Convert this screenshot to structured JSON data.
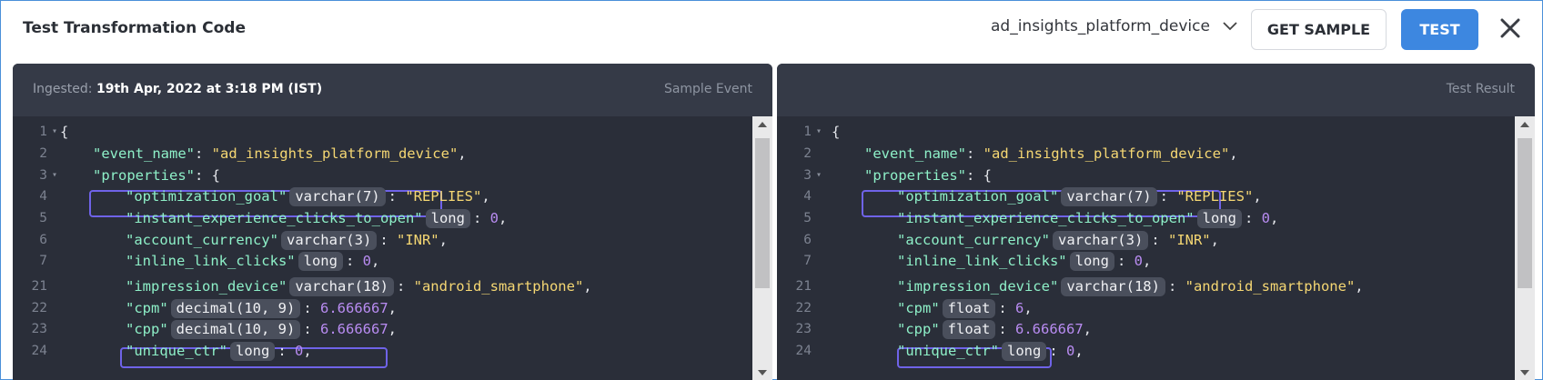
{
  "header": {
    "title": "Test Transformation Code",
    "event_selector": "ad_insights_platform_device",
    "get_sample_label": "GET SAMPLE",
    "test_label": "TEST"
  },
  "left_panel": {
    "ingested_label": "Ingested:",
    "ingested_value": "19th Apr, 2022 at 3:18 PM (IST)",
    "panel_label": "Sample Event",
    "lines": [
      {
        "ln": "1",
        "fold": true,
        "segments": [
          {
            "t": "{",
            "c": "p"
          }
        ]
      },
      {
        "ln": "2",
        "indent": 1,
        "segments": [
          {
            "t": "\"event_name\"",
            "c": "k"
          },
          {
            "t": ": ",
            "c": "p"
          },
          {
            "t": "\"ad_insights_platform_device\"",
            "c": "s"
          },
          {
            "t": ",",
            "c": "p"
          }
        ]
      },
      {
        "ln": "3",
        "fold": true,
        "indent": 1,
        "segments": [
          {
            "t": "\"properties\"",
            "c": "k"
          },
          {
            "t": ": {",
            "c": "p"
          }
        ]
      },
      {
        "ln": "4",
        "indent": 2,
        "segments": [
          {
            "t": "\"optimization_goal\"",
            "c": "k"
          },
          {
            "t": "varchar(7)",
            "c": "type"
          },
          {
            "t": ": ",
            "c": "p"
          },
          {
            "t": "\"REPLIES\"",
            "c": "s"
          },
          {
            "t": ",",
            "c": "p"
          }
        ]
      },
      {
        "ln": "5",
        "indent": 2,
        "segments": [
          {
            "t": "\"instant_experience_clicks_to_open\"",
            "c": "k"
          },
          {
            "t": "long",
            "c": "type"
          },
          {
            "t": ": ",
            "c": "p"
          },
          {
            "t": "0",
            "c": "n"
          },
          {
            "t": ",",
            "c": "p"
          }
        ]
      },
      {
        "ln": "6",
        "indent": 2,
        "segments": [
          {
            "t": "\"account_currency\"",
            "c": "k"
          },
          {
            "t": "varchar(3)",
            "c": "type"
          },
          {
            "t": ": ",
            "c": "p"
          },
          {
            "t": "\"INR\"",
            "c": "s"
          },
          {
            "t": ",",
            "c": "p"
          }
        ]
      },
      {
        "ln": "7",
        "indent": 2,
        "segments": [
          {
            "t": "\"inline_link_clicks\"",
            "c": "k"
          },
          {
            "t": "long",
            "c": "type"
          },
          {
            "t": ": ",
            "c": "p"
          },
          {
            "t": "0",
            "c": "n"
          },
          {
            "t": ",",
            "c": "p"
          }
        ]
      },
      {
        "ln": "21",
        "indent": 2,
        "segments": [
          {
            "t": "\"impression_device\"",
            "c": "k"
          },
          {
            "t": "varchar(18)",
            "c": "type"
          },
          {
            "t": ": ",
            "c": "p"
          },
          {
            "t": "\"android_smartphone\"",
            "c": "s"
          },
          {
            "t": ",",
            "c": "p"
          }
        ]
      },
      {
        "ln": "22",
        "indent": 2,
        "segments": [
          {
            "t": "\"cpm\"",
            "c": "k"
          },
          {
            "t": "decimal(10, 9)",
            "c": "type"
          },
          {
            "t": ": ",
            "c": "p"
          },
          {
            "t": "6.666667",
            "c": "n"
          },
          {
            "t": ",",
            "c": "p"
          }
        ]
      },
      {
        "ln": "23",
        "indent": 2,
        "segments": [
          {
            "t": "\"cpp\"",
            "c": "k"
          },
          {
            "t": "decimal(10, 9)",
            "c": "type"
          },
          {
            "t": ": ",
            "c": "p"
          },
          {
            "t": "6.666667",
            "c": "n"
          },
          {
            "t": ",",
            "c": "p"
          }
        ]
      },
      {
        "ln": "24",
        "indent": 2,
        "segments": [
          {
            "t": "\"unique_ctr\"",
            "c": "k"
          },
          {
            "t": "long",
            "c": "type"
          },
          {
            "t": ": ",
            "c": "p"
          },
          {
            "t": "0",
            "c": "n"
          },
          {
            "t": ",",
            "c": "p"
          }
        ]
      }
    ]
  },
  "right_panel": {
    "panel_label": "Test Result",
    "lines": [
      {
        "ln": "1",
        "fold": true,
        "segments": [
          {
            "t": "{",
            "c": "p"
          }
        ]
      },
      {
        "ln": "2",
        "indent": 1,
        "segments": [
          {
            "t": "\"event_name\"",
            "c": "k"
          },
          {
            "t": ": ",
            "c": "p"
          },
          {
            "t": "\"ad_insights_platform_device\"",
            "c": "s"
          },
          {
            "t": ",",
            "c": "p"
          }
        ]
      },
      {
        "ln": "3",
        "fold": true,
        "indent": 1,
        "segments": [
          {
            "t": "\"properties\"",
            "c": "k"
          },
          {
            "t": ": {",
            "c": "p"
          }
        ]
      },
      {
        "ln": "4",
        "indent": 2,
        "segments": [
          {
            "t": "\"optimization_goal\"",
            "c": "k"
          },
          {
            "t": "varchar(7)",
            "c": "type"
          },
          {
            "t": ": ",
            "c": "p"
          },
          {
            "t": "\"REPLIES\"",
            "c": "s"
          },
          {
            "t": ",",
            "c": "p"
          }
        ]
      },
      {
        "ln": "5",
        "indent": 2,
        "segments": [
          {
            "t": "\"instant_experience_clicks_to_open\"",
            "c": "k"
          },
          {
            "t": "long",
            "c": "type"
          },
          {
            "t": ": ",
            "c": "p"
          },
          {
            "t": "0",
            "c": "n"
          },
          {
            "t": ",",
            "c": "p"
          }
        ]
      },
      {
        "ln": "6",
        "indent": 2,
        "segments": [
          {
            "t": "\"account_currency\"",
            "c": "k"
          },
          {
            "t": "varchar(3)",
            "c": "type"
          },
          {
            "t": ": ",
            "c": "p"
          },
          {
            "t": "\"INR\"",
            "c": "s"
          },
          {
            "t": ",",
            "c": "p"
          }
        ]
      },
      {
        "ln": "7",
        "indent": 2,
        "segments": [
          {
            "t": "\"inline_link_clicks\"",
            "c": "k"
          },
          {
            "t": "long",
            "c": "type"
          },
          {
            "t": ": ",
            "c": "p"
          },
          {
            "t": "0",
            "c": "n"
          },
          {
            "t": ",",
            "c": "p"
          }
        ]
      },
      {
        "ln": "21",
        "indent": 2,
        "segments": [
          {
            "t": "\"impression_device\"",
            "c": "k"
          },
          {
            "t": "varchar(18)",
            "c": "type"
          },
          {
            "t": ": ",
            "c": "p"
          },
          {
            "t": "\"android_smartphone\"",
            "c": "s"
          },
          {
            "t": ",",
            "c": "p"
          }
        ]
      },
      {
        "ln": "22",
        "indent": 2,
        "segments": [
          {
            "t": "\"cpm\"",
            "c": "k"
          },
          {
            "t": "float",
            "c": "type"
          },
          {
            "t": ": ",
            "c": "p"
          },
          {
            "t": "6",
            "c": "n"
          },
          {
            "t": ",",
            "c": "p"
          }
        ]
      },
      {
        "ln": "23",
        "indent": 2,
        "segments": [
          {
            "t": "\"cpp\"",
            "c": "k"
          },
          {
            "t": "float",
            "c": "type"
          },
          {
            "t": ": ",
            "c": "p"
          },
          {
            "t": "6.666667",
            "c": "n"
          },
          {
            "t": ",",
            "c": "p"
          }
        ]
      },
      {
        "ln": "24",
        "indent": 2,
        "segments": [
          {
            "t": "\"unique_ctr\"",
            "c": "k"
          },
          {
            "t": "long",
            "c": "type"
          },
          {
            "t": ": ",
            "c": "p"
          },
          {
            "t": "0",
            "c": "n"
          },
          {
            "t": ",",
            "c": "p"
          }
        ]
      }
    ]
  },
  "colors": {
    "accent": "#3d87e0",
    "highlight": "#6f63e8",
    "key": "#8ef0c8",
    "string": "#f5d773",
    "number": "#b98cf2"
  }
}
